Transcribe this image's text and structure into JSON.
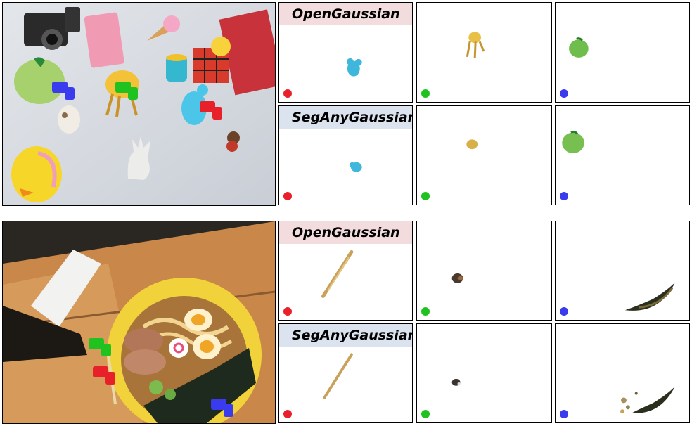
{
  "figure": {
    "rows": [
      {
        "id": "toys",
        "methods": [
          "OpenGaussian",
          "SegAnyGaussian"
        ],
        "prompt_colors": [
          "#e8202a",
          "#1fc21f",
          "#3a3aef"
        ],
        "objects": [
          "blue-toy",
          "yellow-toy",
          "green-apple"
        ]
      },
      {
        "id": "ramen",
        "methods": [
          "OpenGaussian",
          "SegAnyGaussian"
        ],
        "prompt_colors": [
          "#e8202a",
          "#1fc21f",
          "#3a3aef"
        ],
        "objects": [
          "chopsticks",
          "soy-bottle-tip",
          "nori-seaweed"
        ]
      }
    ]
  }
}
